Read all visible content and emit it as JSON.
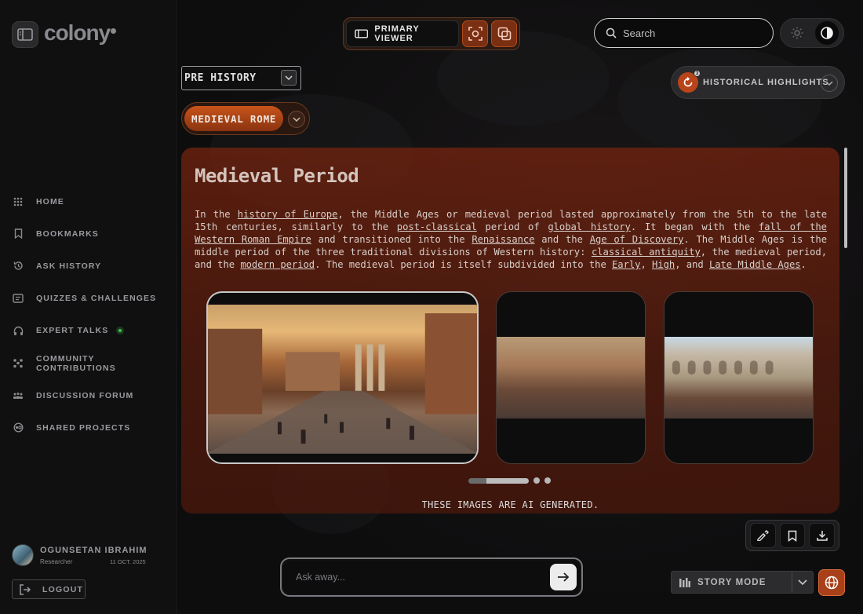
{
  "app": {
    "logo_text": "colony"
  },
  "sidebar": {
    "items": [
      {
        "label": "HOME",
        "icon": "grid-icon"
      },
      {
        "label": "BOOKMARKS",
        "icon": "bookmark-icon"
      },
      {
        "label": "ASK HISTORY",
        "icon": "history-icon"
      },
      {
        "label": "QUIZZES & CHALLENGES",
        "icon": "quiz-icon"
      },
      {
        "label": "EXPERT TALKS",
        "icon": "headphones-icon",
        "live": true
      },
      {
        "label": "COMMUNITY CONTRIBUTIONS",
        "icon": "community-icon"
      },
      {
        "label": "DISCUSSION FORUM",
        "icon": "forum-icon"
      },
      {
        "label": "SHARED PROJECTS",
        "icon": "projects-icon"
      }
    ],
    "user": {
      "name": "OGUNSETAN IBRAHIM",
      "role": "Researcher",
      "date": "11 OCT. 2025"
    },
    "logout_label": "LOGOUT"
  },
  "header": {
    "viewer_label": "PRIMARY VIEWER",
    "search_placeholder": "Search",
    "theme": "dark"
  },
  "filters": {
    "era": "PRE HISTORY",
    "topic": "MEDIEVAL ROME",
    "highlights_label": "HISTORICAL HIGHLIGHTS",
    "highlights_badge": "3"
  },
  "article": {
    "title": "Medieval Period",
    "p": {
      "t1": "In the ",
      "l1": "history of Europe",
      "t2": ", the Middle Ages or medieval period lasted approximately from the 5th to the late 15th centuries, similarly to the ",
      "l2": "post-classical",
      "t3": " period of ",
      "l3": "global history",
      "t4": ". It began with the ",
      "l4": "fall of the Western Roman Empire",
      "t5": " and transitioned into the ",
      "l5": "Renaissance",
      "t6": " and the ",
      "l6": "Age of Discovery",
      "t7": ". The Middle Ages is the middle period of the three traditional divisions of Western history: ",
      "l7": "classical antiquity",
      "t8": ", the medieval period, and the ",
      "l8": "modern period",
      "t9": ". The medieval period is itself subdivided into the ",
      "l9": "Early",
      "t10": ", ",
      "l10": "High",
      "t11": ", and ",
      "l11": "Late Middle Ages",
      "t12": "."
    },
    "carousel": {
      "slides": 3,
      "active": 1
    },
    "disclaimer": "THESE IMAGES ARE AI GENERATED."
  },
  "composer": {
    "placeholder": "Ask away..."
  },
  "story_mode": {
    "label": "STORY MODE"
  },
  "colors": {
    "accent": "#c8541a",
    "panel": "#6e2410"
  }
}
